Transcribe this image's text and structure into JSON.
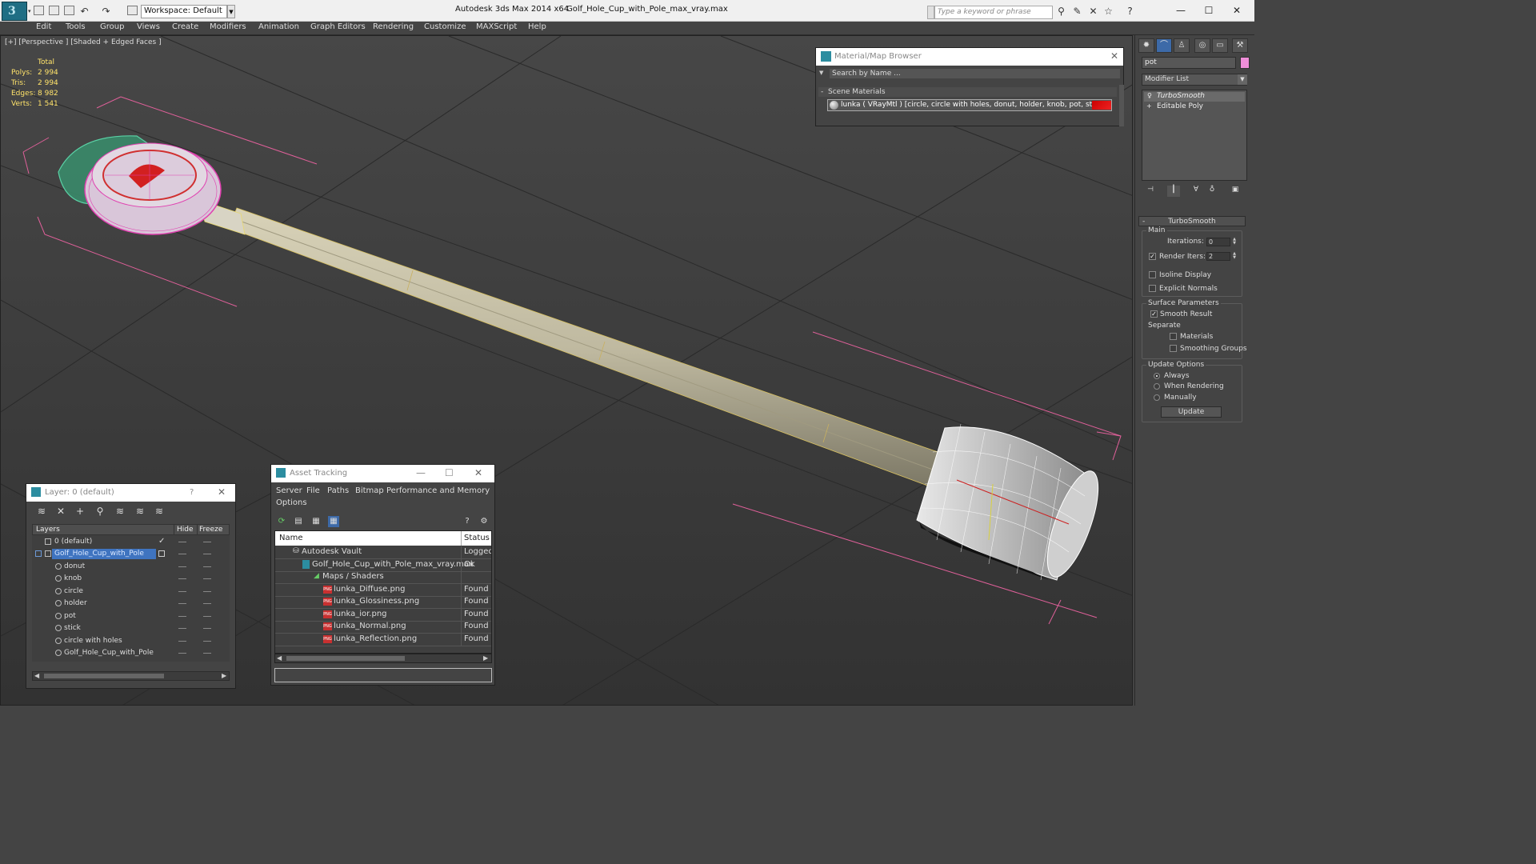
{
  "titlebar": {
    "workspace": "Workspace: Default",
    "app": "Autodesk 3ds Max  2014 x64",
    "file": "Golf_Hole_Cup_with_Pole_max_vray.max",
    "search_placeholder": "Type a keyword or phrase"
  },
  "menu": [
    "Edit",
    "Tools",
    "Group",
    "Views",
    "Create",
    "Modifiers",
    "Animation",
    "Graph Editors",
    "Rendering",
    "Customize",
    "MAXScript",
    "Help"
  ],
  "viewport": {
    "label": "[+] [Perspective ] [Shaded + Edged Faces ]",
    "stats_header": "Total",
    "stats": [
      {
        "label": "Polys:",
        "value": "2 994"
      },
      {
        "label": "Tris:",
        "value": "2 994"
      },
      {
        "label": "Edges:",
        "value": "8 982"
      },
      {
        "label": "Verts:",
        "value": "1 541"
      }
    ]
  },
  "material_browser": {
    "title": "Material/Map Browser",
    "search_placeholder": "Search by Name ...",
    "section": "Scene Materials",
    "item": "lunka  ( VRayMtl )  [circle, circle with holes, donut, holder, knob, pot, stick]"
  },
  "command_panel": {
    "object_name": "pot",
    "object_color": "#ee8ed8",
    "modifier_list": "Modifier List",
    "stack": [
      "TurboSmooth",
      "Editable Poly"
    ],
    "rollout": "TurboSmooth",
    "main_group": "Main",
    "iterations_label": "Iterations:",
    "iterations": "0",
    "render_iters_label": "Render Iters:",
    "render_iters": "2",
    "isoline": "Isoline Display",
    "explicit_normals": "Explicit Normals",
    "surface_params": "Surface Parameters",
    "smooth_result": "Smooth Result",
    "separate": "Separate",
    "materials": "Materials",
    "smoothing_groups": "Smoothing Groups",
    "update_options": "Update Options",
    "always": "Always",
    "when_rendering": "When Rendering",
    "manually": "Manually",
    "update_button": "Update"
  },
  "layers": {
    "title": "Layer: 0 (default)",
    "help": "?",
    "col_layers": "Layers",
    "col_hide": "Hide",
    "col_freeze": "Freeze",
    "rows": [
      {
        "name": "0 (default)",
        "level": 0,
        "selected": false
      },
      {
        "name": "Golf_Hole_Cup_with_Pole",
        "level": 0,
        "selected": true
      },
      {
        "name": "donut",
        "level": 1,
        "selected": false
      },
      {
        "name": "knob",
        "level": 1,
        "selected": false
      },
      {
        "name": "circle",
        "level": 1,
        "selected": false
      },
      {
        "name": "holder",
        "level": 1,
        "selected": false
      },
      {
        "name": "pot",
        "level": 1,
        "selected": false
      },
      {
        "name": "stick",
        "level": 1,
        "selected": false
      },
      {
        "name": "circle with holes",
        "level": 1,
        "selected": false
      },
      {
        "name": "Golf_Hole_Cup_with_Pole",
        "level": 1,
        "selected": false
      }
    ]
  },
  "asset_tracking": {
    "title": "Asset Tracking",
    "menu": [
      "Server",
      "File",
      "Paths",
      "Bitmap Performance and Memory",
      "Options"
    ],
    "col_name": "Name",
    "col_status": "Status",
    "rows": [
      {
        "name": "Autodesk Vault",
        "status": "Logged",
        "level": 0
      },
      {
        "name": "Golf_Hole_Cup_with_Pole_max_vray.max",
        "status": "Ok",
        "level": 1
      },
      {
        "name": "Maps / Shaders",
        "status": "",
        "level": 2
      },
      {
        "name": "lunka_Diffuse.png",
        "status": "Found",
        "level": 3
      },
      {
        "name": "lunka_Glossiness.png",
        "status": "Found",
        "level": 3
      },
      {
        "name": "lunka_ior.png",
        "status": "Found",
        "level": 3
      },
      {
        "name": "lunka_Normal.png",
        "status": "Found",
        "level": 3
      },
      {
        "name": "lunka_Reflection.png",
        "status": "Found",
        "level": 3
      }
    ]
  }
}
